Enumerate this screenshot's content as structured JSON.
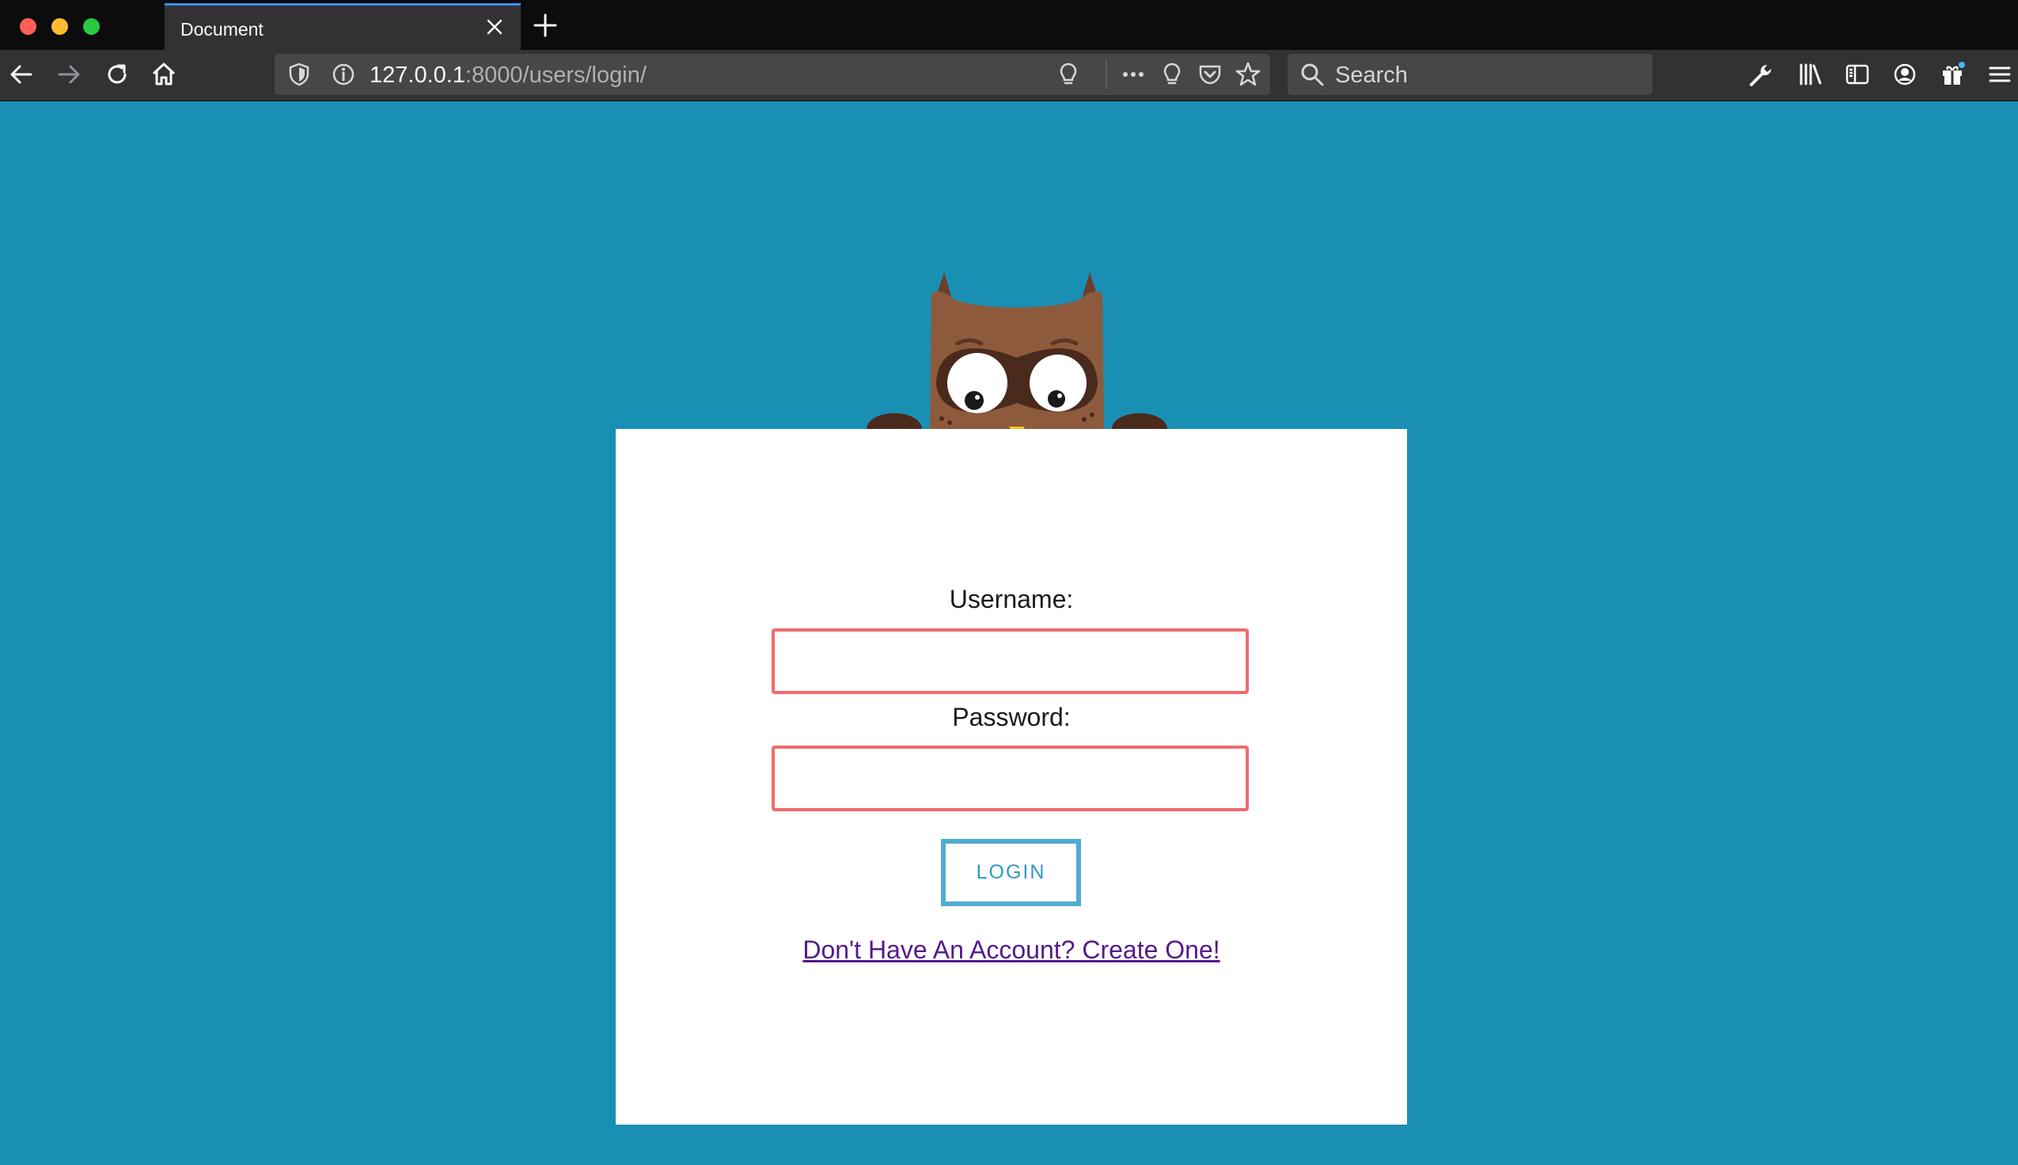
{
  "browser": {
    "tab_title": "Document",
    "url_host": "127.0.0.1",
    "url_rest": ":8000/users/login/",
    "search_placeholder": "Search",
    "colors": {
      "tab_accent": "#3d8ff5",
      "chrome_bg": "#323234",
      "titlebar_bg": "#0c0c0d"
    }
  },
  "icons": {
    "toolbar": [
      "back-icon",
      "forward-icon",
      "reload-icon",
      "home-icon"
    ],
    "urlbar": [
      "shield-icon",
      "info-icon",
      "lightbulb-icon",
      "more-icon",
      "lightbulb-icon",
      "pocket-icon",
      "star-icon"
    ],
    "right": [
      "wrench-icon",
      "library-icon",
      "sidebar-icon",
      "account-icon",
      "gift-icon",
      "menu-icon"
    ]
  },
  "page": {
    "background": "#1a8fb4",
    "username_label": "Username:",
    "password_label": "Password:",
    "login_button": "LOGIN",
    "signup_link": "Don't Have An Account? Create One!",
    "input_border_color": "#ef6b6f",
    "button_border_color": "#50acd1"
  }
}
